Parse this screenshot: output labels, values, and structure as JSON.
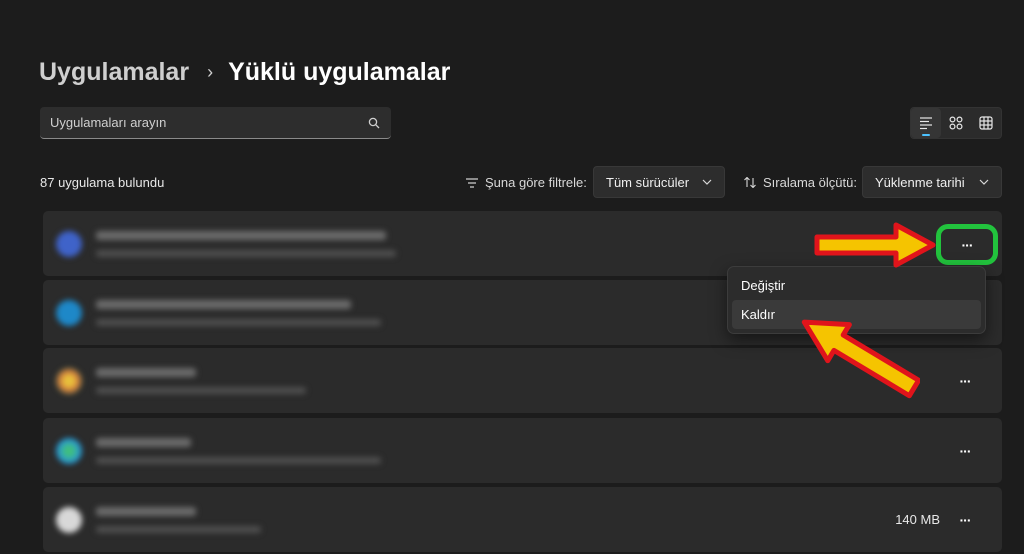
{
  "breadcrumb": {
    "parent": "Uygulamalar",
    "separator": "›",
    "current": "Yüklü uygulamalar"
  },
  "search": {
    "placeholder": "Uygulamaları arayın",
    "icon": "search-icon"
  },
  "view_modes": [
    {
      "name": "list-view",
      "icon": "list-view-icon",
      "active": true
    },
    {
      "name": "grid-view",
      "icon": "grid-view-icon",
      "active": false
    },
    {
      "name": "tile-view",
      "icon": "tile-view-icon",
      "active": false
    }
  ],
  "results": {
    "count_text": "87 uygulama bulundu"
  },
  "filter": {
    "label": "Şuna göre filtrele:",
    "selected": "Tüm sürücüler"
  },
  "sort": {
    "label": "Sıralama ölçütü:",
    "selected": "Yüklenme tarihi"
  },
  "apps": [
    {
      "size": "",
      "more": "···",
      "icon_color": "#3f63c9"
    },
    {
      "size": "",
      "more": "···",
      "icon_color": "#1e88c8"
    },
    {
      "size": "",
      "more": "···",
      "icon_color": "#d0643a"
    },
    {
      "size": "",
      "more": "···",
      "icon_color": "#2a9bd6"
    },
    {
      "size": "140 MB",
      "more": "···",
      "icon_color": "#d8d8d8"
    }
  ],
  "context_menu": {
    "items": [
      "Değiştir",
      "Kaldır"
    ],
    "hovered_index": 1
  },
  "annotations": {
    "arrow_fill": "#f5c400",
    "arrow_stroke": "#e0141b",
    "highlight_color": "#22c33d"
  }
}
